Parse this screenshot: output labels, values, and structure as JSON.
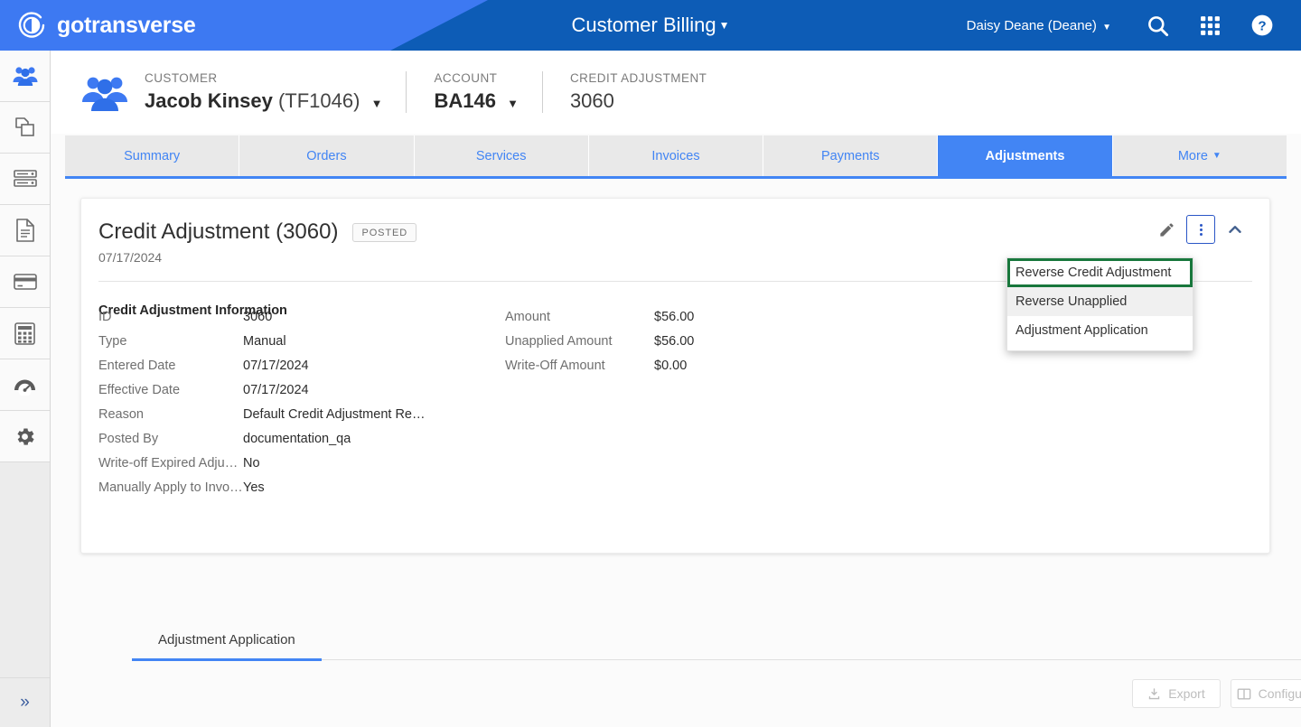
{
  "topbar": {
    "brand": "gotransverse",
    "app_title": "Customer Billing",
    "user": "Daisy Deane (Deane)",
    "icons": [
      "search-icon",
      "apps-grid-icon",
      "help-icon"
    ]
  },
  "sidebar": {
    "items": [
      {
        "icon": "customers-icon",
        "active": true
      },
      {
        "icon": "orders-icon",
        "active": false
      },
      {
        "icon": "servers-icon",
        "active": false
      },
      {
        "icon": "document-icon",
        "active": false
      },
      {
        "icon": "credit-card-icon",
        "active": false
      },
      {
        "icon": "calculator-icon",
        "active": false
      },
      {
        "icon": "gauge-icon",
        "active": false
      },
      {
        "icon": "gear-icon",
        "active": false
      }
    ],
    "expand_label": "»"
  },
  "context": {
    "customer_label": "CUSTOMER",
    "customer_name": "Jacob Kinsey",
    "customer_code": "(TF1046)",
    "account_label": "ACCOUNT",
    "account_value": "BA146",
    "adjustment_label": "CREDIT ADJUSTMENT",
    "adjustment_value": "3060"
  },
  "tabs": [
    {
      "label": "Summary",
      "active": false
    },
    {
      "label": "Orders",
      "active": false
    },
    {
      "label": "Services",
      "active": false
    },
    {
      "label": "Invoices",
      "active": false
    },
    {
      "label": "Payments",
      "active": false
    },
    {
      "label": "Adjustments",
      "active": true
    },
    {
      "label": "More",
      "active": false,
      "caret": true
    }
  ],
  "card": {
    "title": "Credit Adjustment (3060)",
    "badge": "POSTED",
    "date": "07/17/2024",
    "section_title": "Credit Adjustment Information",
    "left_fields": [
      {
        "label": "ID",
        "value": "3060"
      },
      {
        "label": "Type",
        "value": "Manual"
      },
      {
        "label": "Entered Date",
        "value": "07/17/2024"
      },
      {
        "label": "Effective Date",
        "value": "07/17/2024"
      },
      {
        "label": "Reason",
        "value": "Default Credit Adjustment Re…"
      },
      {
        "label": "Posted By",
        "value": "documentation_qa"
      },
      {
        "label": "Write-off Expired Adjustments",
        "value": "No"
      },
      {
        "label": "Manually Apply to Invoice",
        "value": "Yes"
      }
    ],
    "right_fields": [
      {
        "label": "Amount",
        "value": "$56.00"
      },
      {
        "label": "Unapplied Amount",
        "value": "$56.00"
      },
      {
        "label": "Write-Off Amount",
        "value": "$0.00"
      }
    ],
    "actions": [
      "edit-pencil-icon",
      "more-vertical-icon",
      "collapse-chevron-icon"
    ]
  },
  "menu": {
    "items": [
      {
        "label": "Reverse Credit Adjustment",
        "selected": true
      },
      {
        "label": "Reverse Unapplied",
        "hover": true
      },
      {
        "label": "Adjustment Application",
        "hover": false
      }
    ],
    "highlight_color": "#18773c"
  },
  "bottom": {
    "tab_label": "Adjustment Application",
    "export_label": "Export",
    "configure_label": "Configure"
  },
  "colors": {
    "header_dark": "#0d5cb6",
    "header_light": "#3d79f2",
    "accent": "#4285f4"
  }
}
